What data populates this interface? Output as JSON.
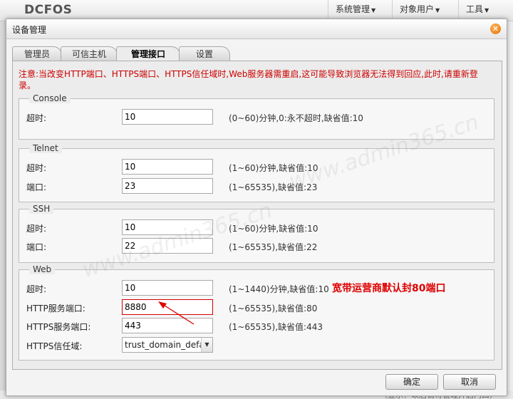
{
  "app": {
    "logo": "DCFOS",
    "menus": [
      {
        "label": "系统管理"
      },
      {
        "label": "对象用户"
      },
      {
        "label": "工具"
      }
    ],
    "bottom_note": "（显示：以后请将管理开启门口）"
  },
  "dialog": {
    "title": "设备管理",
    "tabs": [
      "管理员",
      "可信主机",
      "管理接口",
      "设置"
    ],
    "active_tab": "管理接口",
    "notice": "注意:当改变HTTP端口、HTTPS端口、HTTPS信任域时,Web服务器需重启,这可能导致浏览器无法得到回应,此时,请重新登录。",
    "console": {
      "legend": "Console",
      "timeout_label": "超时:",
      "timeout_value": "10",
      "timeout_hint": "(0~60)分钟,0:永不超时,缺省值:10"
    },
    "telnet": {
      "legend": "Telnet",
      "timeout_label": "超时:",
      "timeout_value": "10",
      "timeout_hint": "(1~60)分钟,缺省值:10",
      "port_label": "端口:",
      "port_value": "23",
      "port_hint": "(1~65535),缺省值:23"
    },
    "ssh": {
      "legend": "SSH",
      "timeout_label": "超时:",
      "timeout_value": "10",
      "timeout_hint": "(1~60)分钟,缺省值:10",
      "port_label": "端口:",
      "port_value": "22",
      "port_hint": "(1~65535),缺省值:22"
    },
    "web": {
      "legend": "Web",
      "timeout_label": "超时:",
      "timeout_value": "10",
      "timeout_hint": "(1~1440)分钟,缺省值:10",
      "http_label": "HTTP服务端口:",
      "http_value": "8880",
      "http_hint": "(1~65535),缺省值:80",
      "https_label": "HTTPS服务端口:",
      "https_value": "443",
      "https_hint": "(1~65535),缺省值:443",
      "trust_label": "HTTPS信任域:",
      "trust_value": "trust_domain_defau"
    },
    "annotation": "宽带运营商默认封80端口",
    "ok_label": "确定",
    "cancel_label": "取消"
  },
  "watermark": "www.admin365.cn",
  "colors": {
    "notice": "#cc0000",
    "annotation": "#e00000",
    "close_button": "#e07300"
  }
}
